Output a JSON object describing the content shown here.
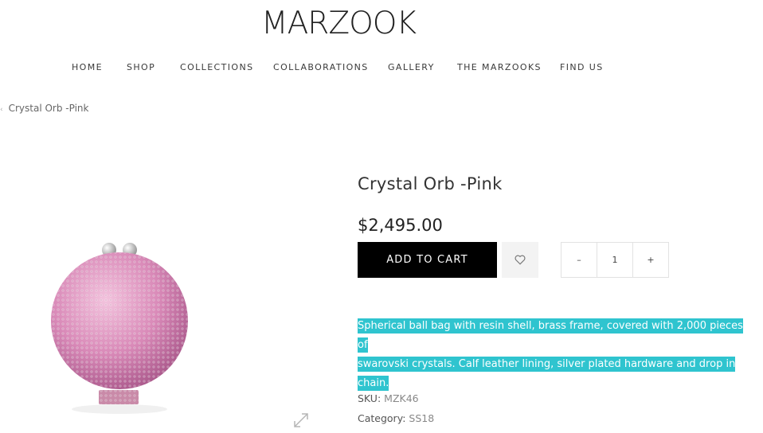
{
  "brand": {
    "name": "MARZOOK"
  },
  "nav": {
    "items": [
      {
        "label": "HOME"
      },
      {
        "label": "SHOP"
      },
      {
        "label": "COLLECTIONS"
      },
      {
        "label": "COLLABORATIONS"
      },
      {
        "label": "GALLERY"
      },
      {
        "label": "THE MARZOOKS"
      },
      {
        "label": "FIND US"
      }
    ]
  },
  "breadcrumb": {
    "current": "Crystal Orb -Pink"
  },
  "product": {
    "title": "Crystal Orb -Pink",
    "price": "$2,495.00",
    "add_to_cart_label": "ADD TO CART",
    "quantity": {
      "minus": "–",
      "value": "1",
      "plus": "+"
    },
    "description_line1": "Spherical ball bag with resin shell, brass frame, covered with 2,000 pieces of",
    "description_line2": "swarovski crystals. Calf leather lining, silver plated hardware and drop in chain.",
    "sku_label": "SKU:",
    "sku_value": "MZK46",
    "category_label": "Category:",
    "category_value": "SS18"
  },
  "colors": {
    "highlight": "#2fc4cf",
    "button": "#000000",
    "orb_pink": "#e3a0c4"
  },
  "icons": {
    "wishlist": "heart-icon",
    "zoom": "expand-icon",
    "breadcrumb_sep": "chevron-left-icon"
  }
}
